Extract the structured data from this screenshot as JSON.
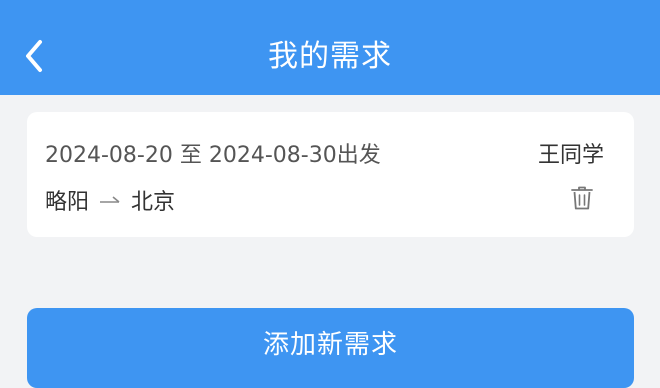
{
  "header": {
    "title": "我的需求",
    "back_icon": "chevron-left-icon",
    "background_color": "#3e95f2"
  },
  "request": {
    "date_range": "2024-08-20 至 2024-08-30出发",
    "user_name": "王同学",
    "origin": "略阳",
    "destination": "北京",
    "arrow_icon": "arrow-right-icon",
    "delete_icon": "trash-icon"
  },
  "actions": {
    "add_label": "添加新需求"
  }
}
